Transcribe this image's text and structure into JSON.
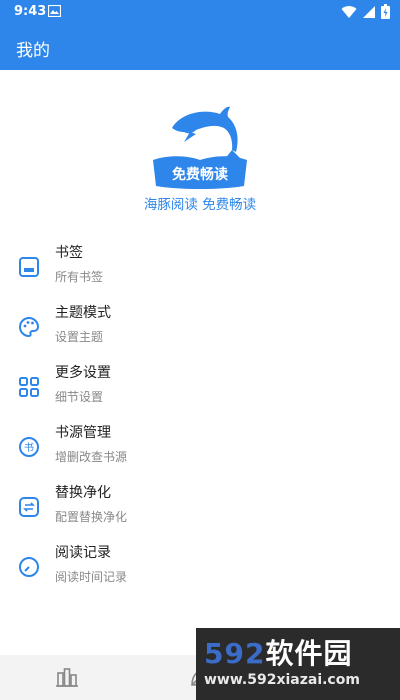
{
  "statusbar": {
    "time": "9:43"
  },
  "appbar": {
    "title": "我的"
  },
  "logo": {
    "badge_text": "免费畅读"
  },
  "slogan": "海豚阅读 免费畅读",
  "menu": [
    {
      "title": "书签",
      "subtitle": "所有书签",
      "icon": "bookmark-icon"
    },
    {
      "title": "主题模式",
      "subtitle": "设置主题",
      "icon": "palette-icon"
    },
    {
      "title": "更多设置",
      "subtitle": "细节设置",
      "icon": "grid-icon"
    },
    {
      "title": "书源管理",
      "subtitle": "增删改查书源",
      "icon": "book-source-icon"
    },
    {
      "title": "替换净化",
      "subtitle": "配置替换净化",
      "icon": "replace-icon"
    },
    {
      "title": "阅读记录",
      "subtitle": "阅读时间记录",
      "icon": "clock-icon"
    }
  ],
  "watermark": {
    "brand_num": "592",
    "brand_text": "软件园",
    "url": "www.592xiazai.com"
  },
  "colors": {
    "primary": "#2e86ea",
    "background": "#ffffff",
    "navbar": "#f3f3f3"
  }
}
